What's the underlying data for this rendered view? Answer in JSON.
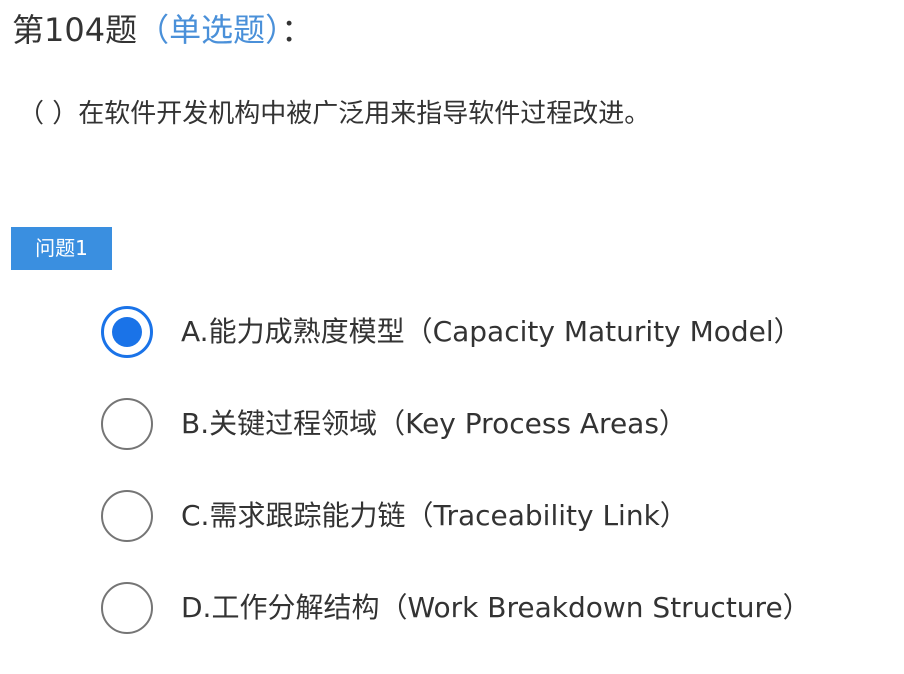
{
  "question": {
    "number_label": "第104题",
    "type_label": "（单选题）",
    "colon": "：",
    "stem": "（ ）在软件开发机构中被广泛用来指导软件过程改进。",
    "tab_label": "问题1",
    "selected_index": 0,
    "options": [
      {
        "text": "A.能力成熟度模型（Capacity Maturity Model）"
      },
      {
        "text": "B.关键过程领域（Key Process Areas）"
      },
      {
        "text": "C.需求跟踪能力链（Traceability Link）"
      },
      {
        "text": "D.工作分解结构（Work Breakdown Structure）"
      }
    ]
  },
  "colors": {
    "accent": "#1a73e8",
    "tag_bg": "#3a8fe0",
    "type_label": "#4a90d9",
    "text": "#333333"
  }
}
